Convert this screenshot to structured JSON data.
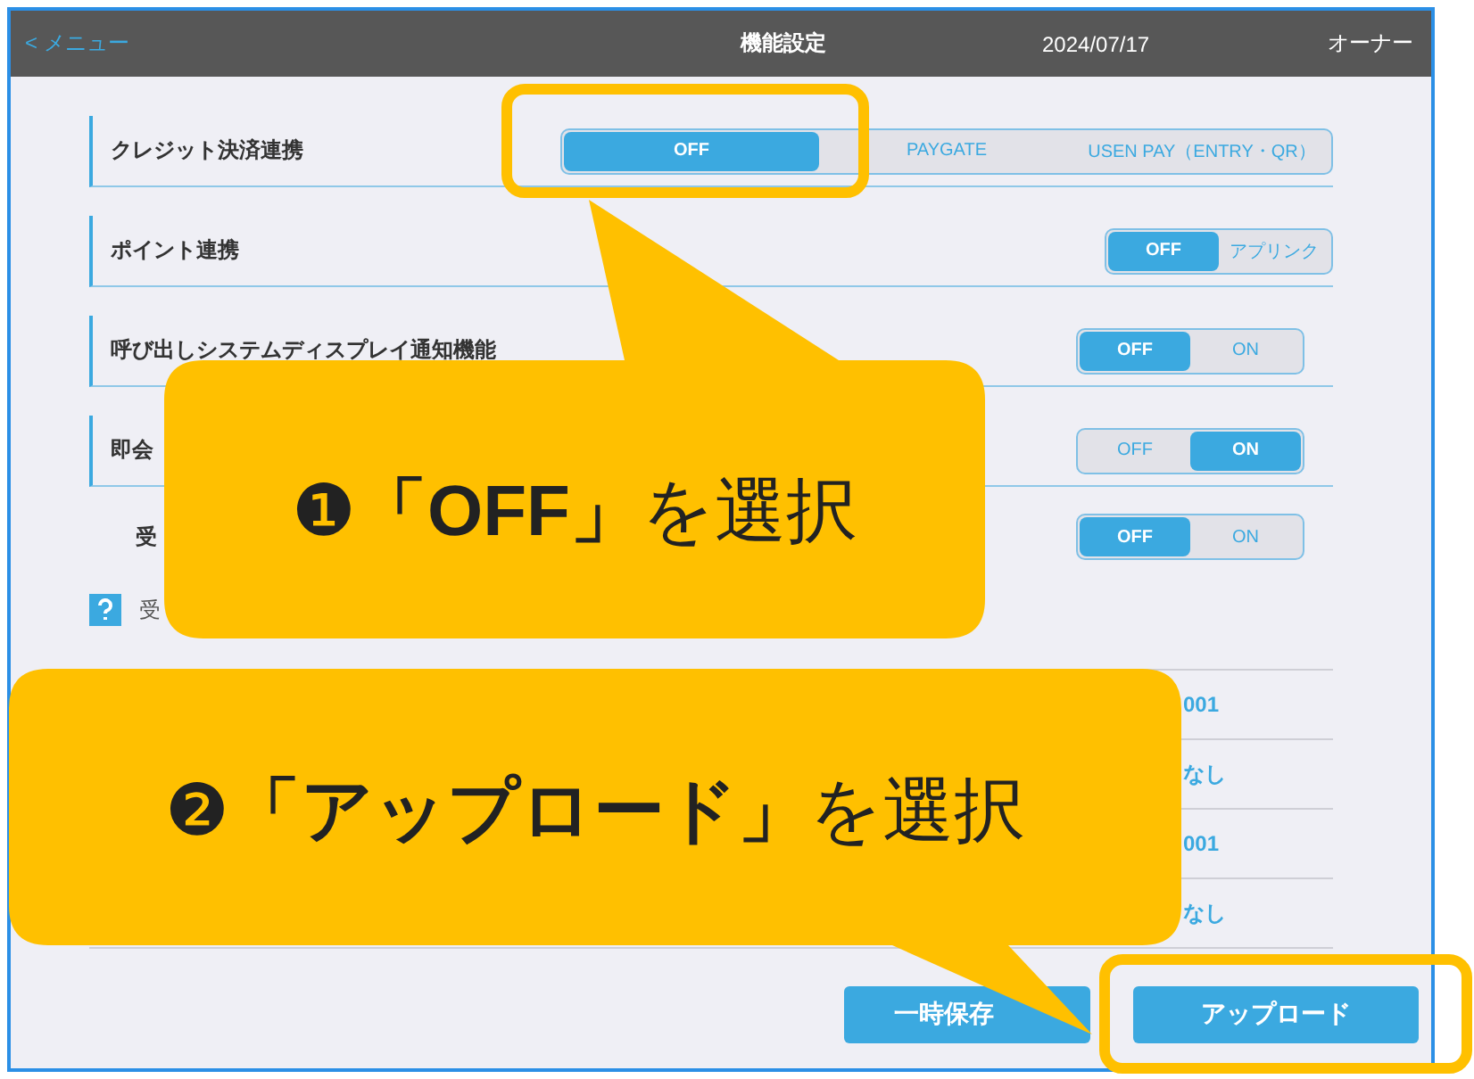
{
  "header": {
    "back": "< メニュー",
    "title": "機能設定",
    "date": "2024/07/17",
    "user": "オーナー"
  },
  "settings": [
    {
      "kind": "row",
      "label": "クレジット決済連携",
      "options": [
        {
          "label": "OFF",
          "selected": true
        },
        {
          "label": "PAYGATE",
          "selected": false
        },
        {
          "label": "USEN PAY（ENTRY・QR）",
          "selected": false
        }
      ]
    },
    {
      "kind": "row",
      "label": "ポイント連携",
      "options": [
        {
          "label": "OFF",
          "selected": true
        },
        {
          "label": "アプリンク",
          "selected": false
        }
      ]
    },
    {
      "kind": "row",
      "label": "呼び出しシステムディスプレイ通知機能",
      "options": [
        {
          "label": "OFF",
          "selected": true
        },
        {
          "label": "ON",
          "selected": false
        }
      ]
    },
    {
      "kind": "row",
      "label": "即会",
      "options": [
        {
          "label": "OFF",
          "selected": false
        },
        {
          "label": "ON",
          "selected": true
        }
      ]
    },
    {
      "kind": "subrow",
      "label": "受",
      "options": [
        {
          "label": "OFF",
          "selected": true
        },
        {
          "label": "ON",
          "selected": false
        }
      ]
    },
    {
      "kind": "help",
      "label": "受"
    }
  ],
  "list": [
    {
      "value": "001"
    },
    {
      "value": "なし"
    },
    {
      "value": "001"
    },
    {
      "value": "なし"
    }
  ],
  "buttons": [
    {
      "label": "一時保存"
    },
    {
      "label": "アップロード"
    }
  ],
  "callouts": [
    {
      "text": "❶**「OFF」**を選択"
    },
    {
      "text": "❷**「アップロード」**を選択"
    }
  ]
}
